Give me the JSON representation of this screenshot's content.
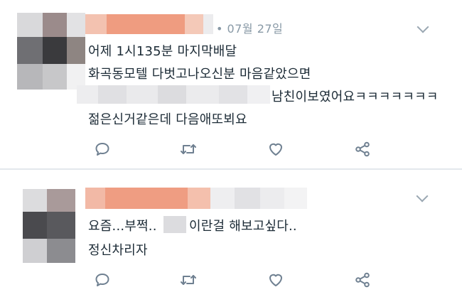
{
  "colors": {
    "text": "#1c2b36",
    "muted": "#8899a6",
    "icon": "#6f8091",
    "divider": "#e3e8ec",
    "blur_orange": "#f0a085",
    "blur_light": "#e7e7e9"
  },
  "tweets": [
    {
      "date": "• 07월 27일",
      "lines": [
        "어제 1시135분 마지막배달",
        "화곡동모텔 다벗고나오신분 마음같았으면",
        "남친이보였어요ㅋㅋㅋㅋㅋㅋㅋ",
        "젊은신거같은데 다음애또뵈요"
      ],
      "icons": [
        "reply-icon",
        "retweet-icon",
        "like-icon",
        "share-icon",
        "chevron-down-icon"
      ]
    },
    {
      "lines": [
        "요즘...부쩍..",
        "이란걸 해보고싶다..",
        "정신차리자"
      ],
      "icons": [
        "reply-icon",
        "retweet-icon",
        "like-icon",
        "share-icon",
        "chevron-down-icon"
      ]
    }
  ]
}
